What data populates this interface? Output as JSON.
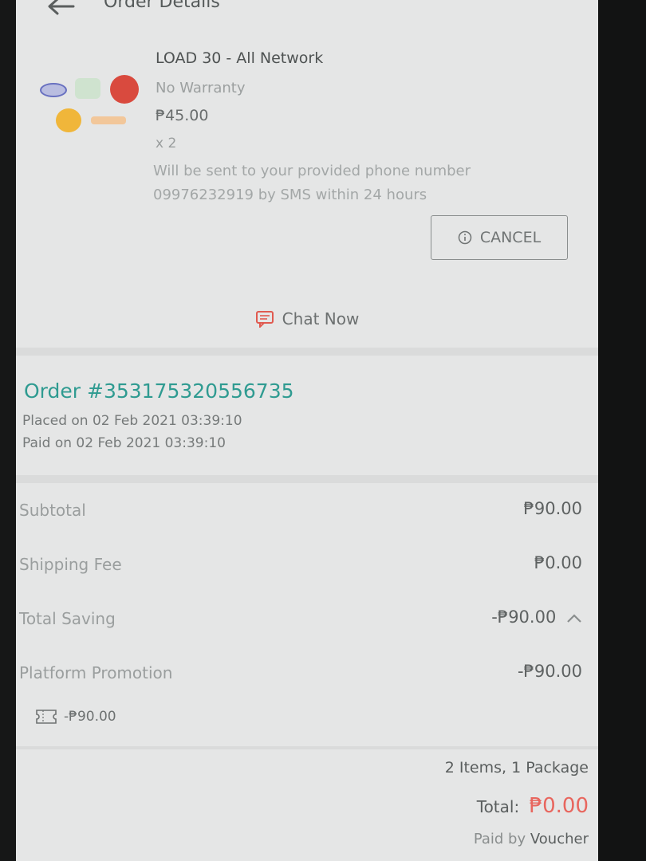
{
  "header": {
    "title": "Order Details"
  },
  "product": {
    "name": "LOAD 30 - All Network",
    "warranty": "No Warranty",
    "price": "₱45.00",
    "quantity": "x 2",
    "delivery_note": "Will be sent to your provided phone number 09976232919 by SMS within 24 hours",
    "cancel_label": "CANCEL"
  },
  "chat": {
    "label": "Chat Now"
  },
  "order": {
    "number": "Order #353175320556735",
    "placed": "Placed on 02 Feb 2021  03:39:10",
    "paid": "Paid on 02 Feb 2021  03:39:10"
  },
  "summary": {
    "subtotal_label": "Subtotal",
    "subtotal_value": "₱90.00",
    "shipping_label": "Shipping Fee",
    "shipping_value": "₱0.00",
    "saving_label": "Total Saving",
    "saving_value": "-₱90.00",
    "promo_label": "Platform Promotion",
    "promo_value": "-₱90.00",
    "voucher_value": "-₱90.00",
    "items_line": "2 Items, 1 Package",
    "total_label": "Total:",
    "total_value": "₱0.00",
    "paid_by_prefix": "Paid by",
    "paid_by_method": "Voucher"
  },
  "colors": {
    "accent_teal": "#2f9b91",
    "total_red": "#e8665e",
    "chat_icon": "#e05a50"
  },
  "icons": [
    "back-arrow-icon",
    "network-logos",
    "info-icon",
    "chat-icon",
    "chevron-up-icon",
    "voucher-icon"
  ]
}
